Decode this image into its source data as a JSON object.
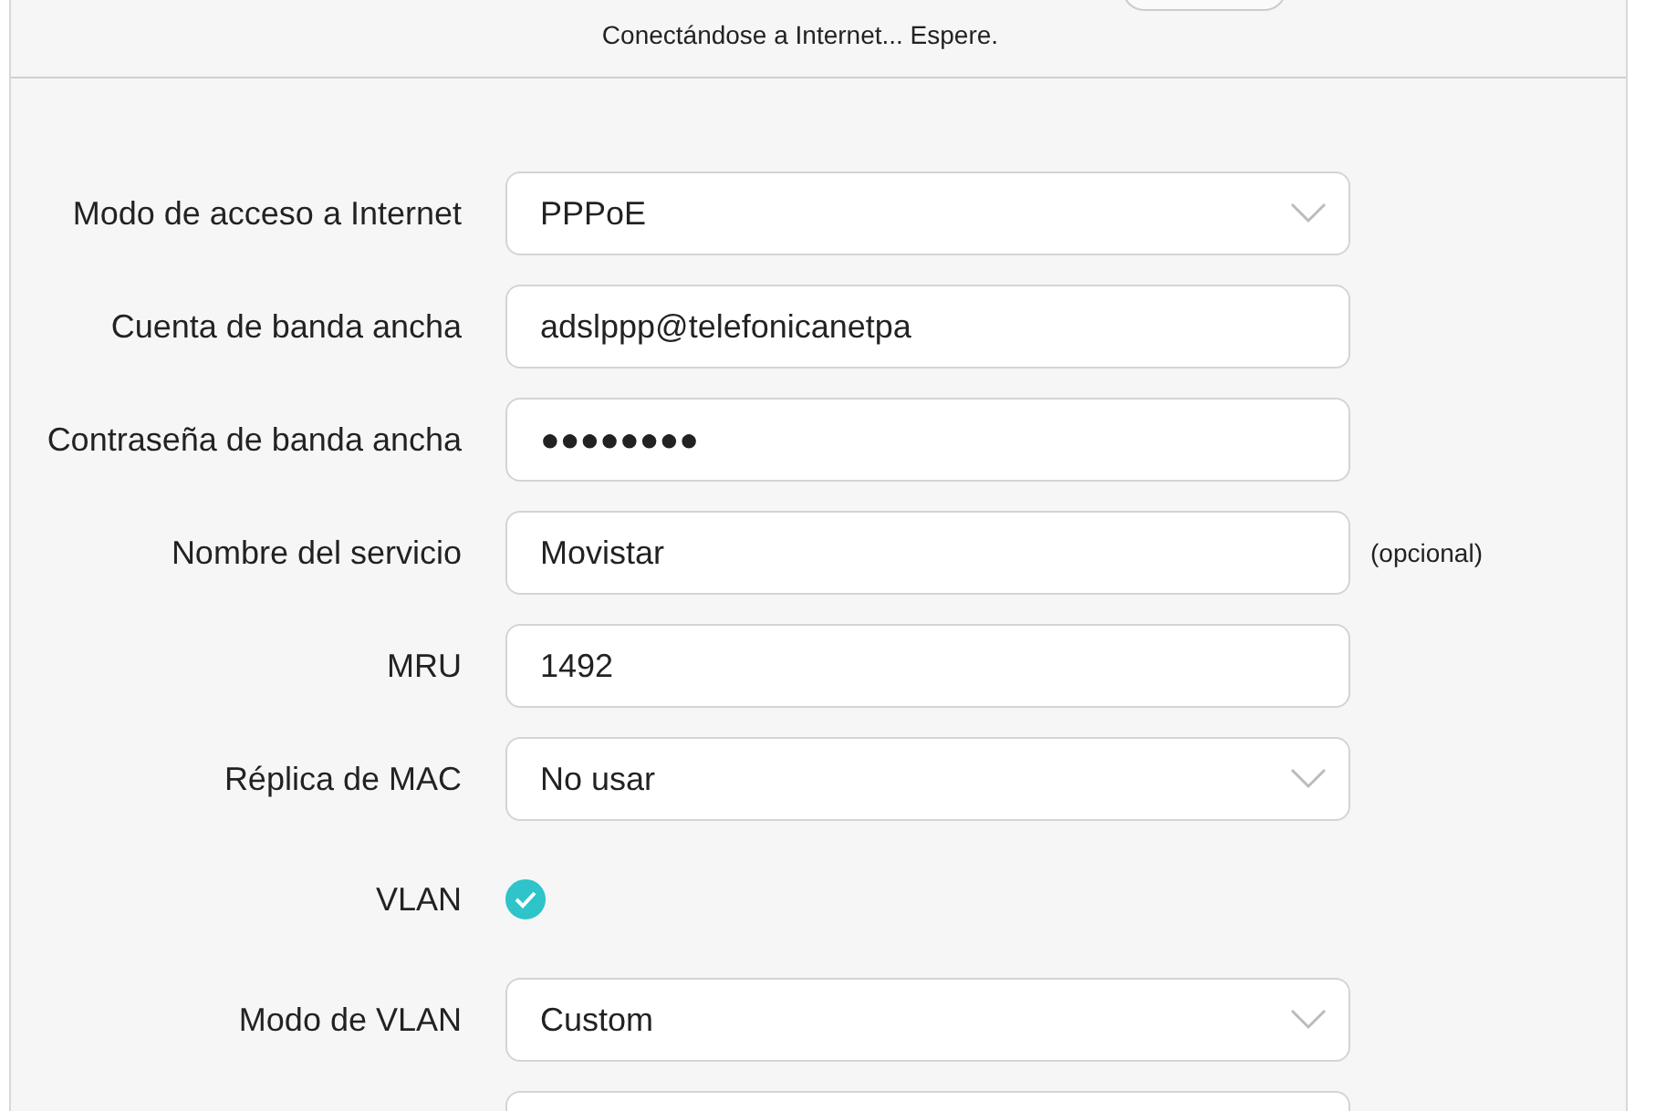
{
  "status": "Conectándose a Internet... Espere.",
  "rows": [
    {
      "kind": "select",
      "label": "Modo de acceso a Internet",
      "value": "PPPoE"
    },
    {
      "kind": "text",
      "label": "Cuenta de banda ancha",
      "value": "adslppp@telefonicanetpa"
    },
    {
      "kind": "text",
      "label": "Contraseña de banda ancha",
      "value": "●●●●●●●●"
    },
    {
      "kind": "text",
      "label": "Nombre del servicio",
      "value": "Movistar",
      "note": "(opcional)"
    },
    {
      "kind": "text",
      "label": "MRU",
      "value": "1492"
    },
    {
      "kind": "select",
      "label": "Réplica de MAC",
      "value": "No usar"
    },
    {
      "kind": "check",
      "label": "VLAN",
      "checked": true
    },
    {
      "kind": "select",
      "label": "Modo de VLAN",
      "value": "Custom"
    },
    {
      "kind": "text"
    }
  ]
}
